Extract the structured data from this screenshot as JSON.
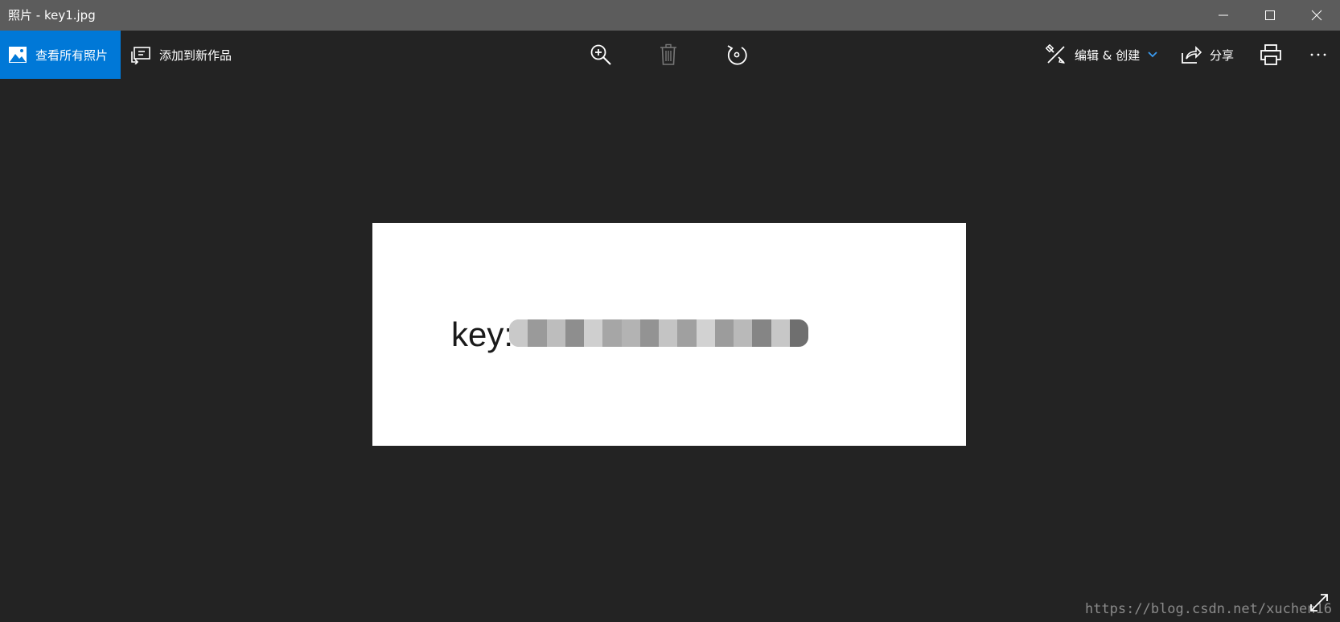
{
  "window": {
    "title": "照片 - key1.jpg"
  },
  "toolbar": {
    "view_all_label": "查看所有照片",
    "add_to_label": "添加到新作品",
    "edit_create_label": "编辑 & 创建",
    "share_label": "分享",
    "icons": {
      "view_all": "photo-icon",
      "add_to": "add-to-album-icon",
      "zoom": "zoom-in-icon",
      "delete": "trash-icon",
      "rotate": "rotate-icon",
      "edit": "edit-create-icon",
      "share": "share-icon",
      "print": "print-icon",
      "more": "more-icon"
    }
  },
  "image": {
    "visible_text": "key:"
  },
  "watermark": "https://blog.csdn.net/xuchen16",
  "colors": {
    "accent": "#0078d7",
    "titlebar": "#5c5c5c",
    "background": "#232323"
  }
}
